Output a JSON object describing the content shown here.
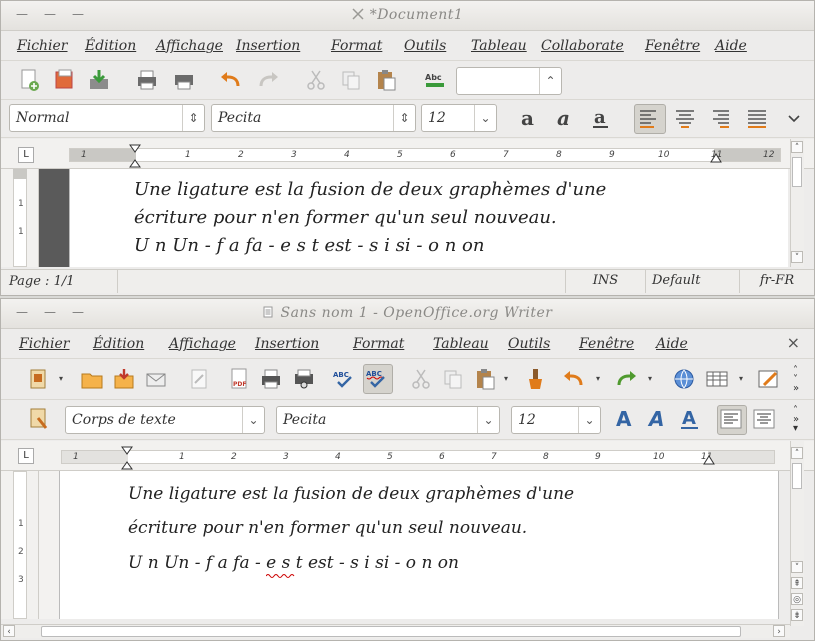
{
  "window1": {
    "title": "*Document1",
    "menus": [
      "Fichier",
      "Édition",
      "Affichage",
      "Insertion",
      "Format",
      "Outils",
      "Tableau",
      "Collaborate",
      "Fenêtre",
      "Aide"
    ],
    "style_value": "Normal",
    "font_value": "Pecita",
    "size_value": "12",
    "ruler_numbers": [
      "1",
      "1",
      "2",
      "3",
      "4",
      "5",
      "6",
      "7",
      "8",
      "9",
      "10",
      "11",
      "12"
    ],
    "vruler_numbers": [
      "1",
      "1"
    ],
    "lines": [
      "Une ligature est la fusion de deux graphèmes d'une",
      "écriture pour n'en former qu'un seul nouveau.",
      "U n Un - f a fa - e s t est - s i si - o n on"
    ],
    "status": {
      "page": "Page : 1/1",
      "ins": "INS",
      "style": "Default",
      "lang": "fr-FR"
    }
  },
  "window2": {
    "title": "Sans nom 1 - OpenOffice.org Writer",
    "menus": [
      "Fichier",
      "Édition",
      "Affichage",
      "Insertion",
      "Format",
      "Tableau",
      "Outils",
      "Fenêtre",
      "Aide"
    ],
    "close": "×",
    "style_value": "Corps de texte",
    "font_value": "Pecita",
    "size_value": "12",
    "ruler_numbers": [
      "1",
      "1",
      "2",
      "3",
      "4",
      "5",
      "6",
      "7",
      "8",
      "9",
      "10",
      "11"
    ],
    "vruler_numbers": [
      "1",
      "2",
      "3"
    ],
    "lines": [
      "Une ligature est la fusion de deux graphèmes d'une",
      "écriture pour n'en former qu'un seul nouveau.",
      "U n Un - f a fa - e s t est - s i si - o n on"
    ]
  },
  "colors": {
    "accent_blue": "#3465a4",
    "orange": "#e07b1a",
    "spell_red": "#cc0000"
  }
}
